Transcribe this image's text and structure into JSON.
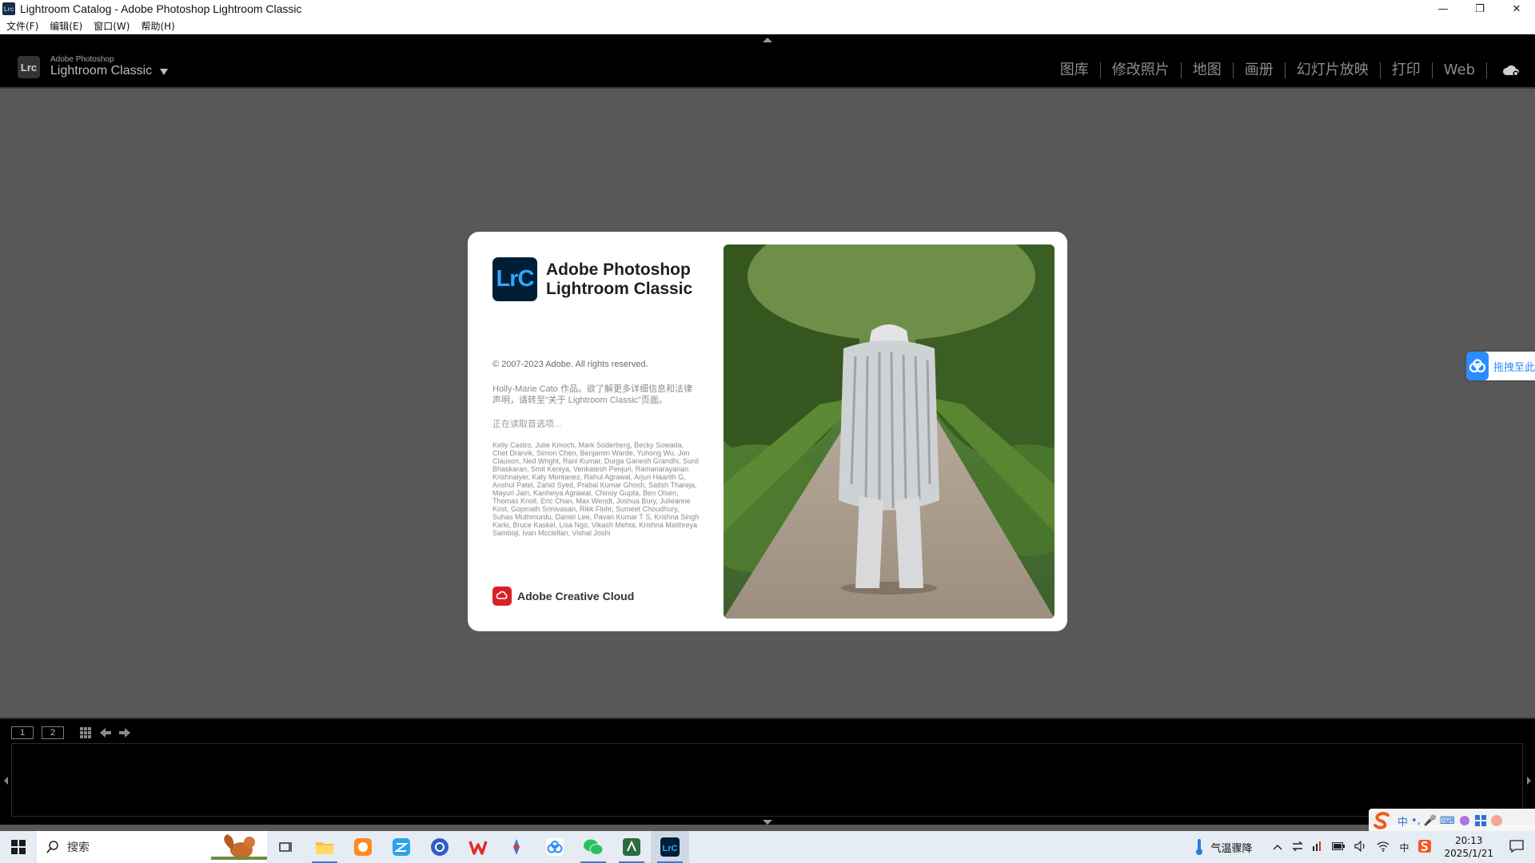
{
  "window": {
    "title": "Lightroom Catalog - Adobe Photoshop Lightroom Classic",
    "app_icon_text": "Lrc",
    "controls": [
      "—",
      "❐",
      "✕"
    ]
  },
  "menubar": [
    "文件(F)",
    "编辑(E)",
    "窗口(W)",
    "帮助(H)"
  ],
  "identity_plate": {
    "small": "Adobe Photoshop",
    "big": "Lightroom Classic",
    "logo_text": "Lrc"
  },
  "modules": [
    "图库",
    "修改照片",
    "地图",
    "画册",
    "幻灯片放映",
    "打印",
    "Web"
  ],
  "splash": {
    "logo_text": "LrC",
    "product_line1": "Adobe Photoshop",
    "product_line2": "Lightroom Classic",
    "copyright": "© 2007-2023 Adobe. All rights reserved.",
    "credit": "Holly-Marie Cato 作品。欲了解更多详细信息和法律声明，请转至“关于 Lightroom Classic”页面。",
    "loading": "正在读取首选项...",
    "names": "Kelly Castro, Julie Kmoch, Mark Soderberg, Becky Sowada, Chet Drarvik, Simon Chen, Benjamin Warde, Yuhong Wu, Jon Clauson, Ned Wright, Rani Kumar, Durga Ganesh Grandhi, Sunil Bhaskaran, Smit Keniya, Venkatesh Penjuri, Ramanarayanan Krishnaiyer, Katy Montanez, Rahul Agrawal, Arjun Haarith G, Anshul Patel, Zahid Syed, Prabal Kumar Ghosh, Satish Thareja, Mayuri Jain, Kanheiya Agrawal, Chinoy Gupta, Ben Olsen, Thomas Knoll, Eric Chan, Max Wendt, Joshua Bury, Julieanne Kost, Gopinath Srinivasan, Rikk Flohr, Sumeet Choudhury, Suhas Muthmurdu, Daniel Lee, Pavan Kumar T S, Krishna Singh Karki, Bruce Kaskel, Lisa Ngo, Vikash Mehta, Krishna Maithreya Samboji, Ivan Mcclellan, Vishal Joshi",
    "cc_label": "Adobe Creative Cloud"
  },
  "side_widget": {
    "label": "拖拽至此"
  },
  "filmstrip": {
    "monitor1": "1",
    "monitor2": "2"
  },
  "ime": [
    "中",
    "•,",
    "🎤",
    "⌨"
  ],
  "taskbar": {
    "search_placeholder": "搜索",
    "weather_text": "气温骤降",
    "tray_lang": "中",
    "time": "20:13",
    "date": "2025/1/21"
  },
  "colors": {
    "accent": "#31a8ff",
    "lrc_bg": "#001e36",
    "cc_red": "#da1f26",
    "baidu_blue": "#2b8cff"
  }
}
